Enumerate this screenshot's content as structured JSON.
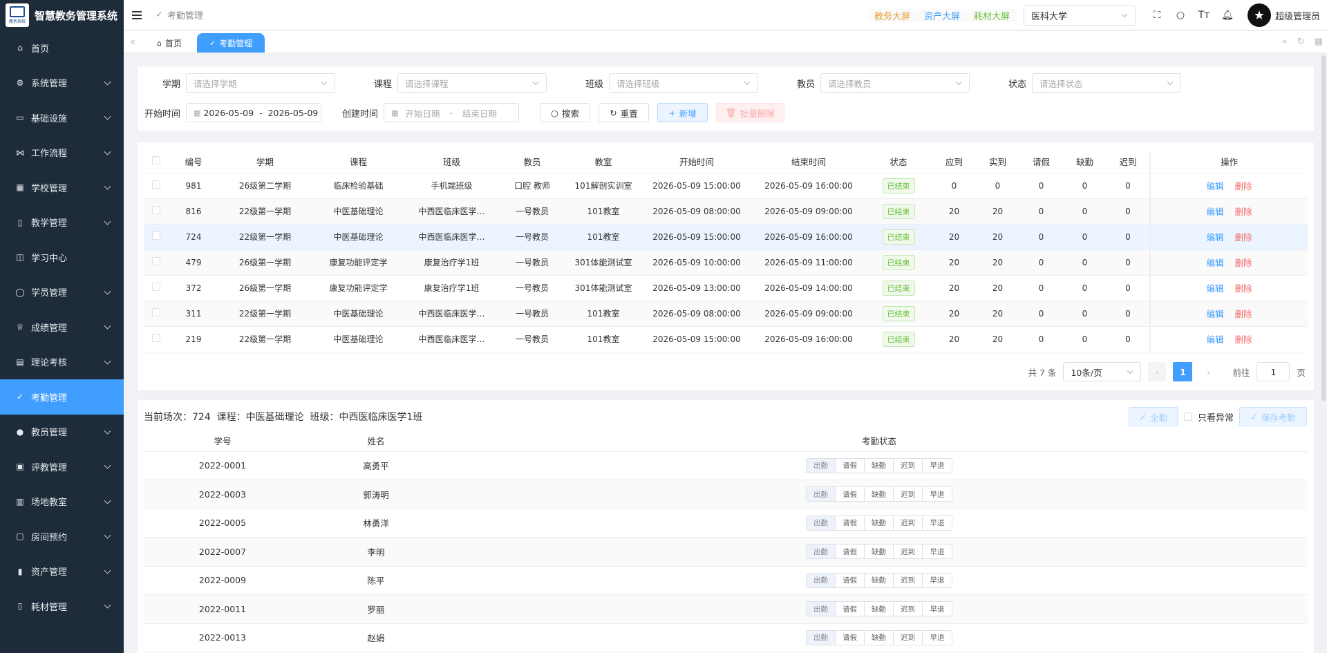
{
  "app": {
    "title": "智慧教务管理系统",
    "logo_caption": "教务系统"
  },
  "sidebar": {
    "items": [
      {
        "label": "首页",
        "icon": "home-icon",
        "glyph": "⌂",
        "has_children": false
      },
      {
        "label": "系统管理",
        "icon": "gear-icon",
        "glyph": "⚙",
        "has_children": true
      },
      {
        "label": "基础设施",
        "icon": "monitor-icon",
        "glyph": "▭",
        "has_children": true
      },
      {
        "label": "工作流程",
        "icon": "workflow-icon",
        "glyph": "⋈",
        "has_children": true
      },
      {
        "label": "学校管理",
        "icon": "school-icon",
        "glyph": "▦",
        "has_children": true
      },
      {
        "label": "教学管理",
        "icon": "book-icon",
        "glyph": "▯",
        "has_children": true
      },
      {
        "label": "学习中心",
        "icon": "open-book-icon",
        "glyph": "◫",
        "has_children": false
      },
      {
        "label": "学员管理",
        "icon": "user-icon",
        "glyph": "◯",
        "has_children": true
      },
      {
        "label": "成绩管理",
        "icon": "medal-icon",
        "glyph": "♕",
        "has_children": true
      },
      {
        "label": "理论考核",
        "icon": "exam-icon",
        "glyph": "▤",
        "has_children": true
      },
      {
        "label": "考勤管理",
        "icon": "check-icon",
        "glyph": "✓",
        "has_children": false,
        "active": true
      },
      {
        "label": "教员管理",
        "icon": "teacher-icon",
        "glyph": "●",
        "has_children": true
      },
      {
        "label": "评教管理",
        "icon": "evaluate-icon",
        "glyph": "▣",
        "has_children": true
      },
      {
        "label": "场地教室",
        "icon": "building-icon",
        "glyph": "▥",
        "has_children": true
      },
      {
        "label": "房间预约",
        "icon": "room-icon",
        "glyph": "▢",
        "has_children": true
      },
      {
        "label": "资产管理",
        "icon": "chart-icon",
        "glyph": "▮",
        "has_children": true
      },
      {
        "label": "耗材管理",
        "icon": "bookmark-icon",
        "glyph": "▯",
        "has_children": true
      }
    ]
  },
  "header": {
    "breadcrumb": "考勤管理",
    "screens": [
      "教务大屏",
      "资产大屏",
      "耗材大屏"
    ],
    "university": "医科大学",
    "username": "超级管理员"
  },
  "tabs": [
    {
      "label": "首页",
      "icon": "home-icon"
    },
    {
      "label": "考勤管理",
      "icon": "check-icon",
      "active": true
    }
  ],
  "filter": {
    "semester": {
      "label": "学期",
      "placeholder": "请选择学期"
    },
    "course": {
      "label": "课程",
      "placeholder": "请选择课程"
    },
    "class": {
      "label": "班级",
      "placeholder": "请选择班级"
    },
    "teacher": {
      "label": "教员",
      "placeholder": "请选择教员"
    },
    "status": {
      "label": "状态",
      "placeholder": "请选择状态"
    },
    "start_time": {
      "label": "开始时间",
      "from": "2026-05-09",
      "sep": "-",
      "to": "2026-05-09"
    },
    "create_time": {
      "label": "创建时间",
      "from_ph": "开始日期",
      "sep": "-",
      "to_ph": "结束日期"
    },
    "search": "搜索",
    "reset": "重置",
    "add": "新增",
    "batch_delete": "批量删除"
  },
  "table": {
    "columns": [
      "编号",
      "学期",
      "课程",
      "班级",
      "教员",
      "教室",
      "开始时间",
      "结束时间",
      "状态",
      "应到",
      "实到",
      "请假",
      "缺勤",
      "迟到",
      "操作"
    ],
    "edit": "编辑",
    "delete": "删除",
    "rows": [
      [
        "981",
        "26级第二学期",
        "临床检验基础",
        "手机端班级",
        "口腔 教师",
        "101解剖实训室",
        "2026-05-09 15:00:00",
        "2026-05-09 16:00:00",
        "已结束",
        "0",
        "0",
        "0",
        "0",
        "0"
      ],
      [
        "816",
        "22级第一学期",
        "中医基础理论",
        "中西医临床医学…",
        "一号教员",
        "101教室",
        "2026-05-09 08:00:00",
        "2026-05-09 09:00:00",
        "已结束",
        "20",
        "20",
        "0",
        "0",
        "0"
      ],
      [
        "724",
        "22级第一学期",
        "中医基础理论",
        "中西医临床医学…",
        "一号教员",
        "101教室",
        "2026-05-09 15:00:00",
        "2026-05-09 16:00:00",
        "已结束",
        "20",
        "20",
        "0",
        "0",
        "0"
      ],
      [
        "479",
        "26级第一学期",
        "康复功能评定学",
        "康复治疗学1班",
        "一号教员",
        "301体能测试室",
        "2026-05-09 10:00:00",
        "2026-05-09 11:00:00",
        "已结束",
        "20",
        "20",
        "0",
        "0",
        "0"
      ],
      [
        "372",
        "26级第一学期",
        "康复功能评定学",
        "康复治疗学1班",
        "一号教员",
        "301体能测试室",
        "2026-05-09 13:00:00",
        "2026-05-09 14:00:00",
        "已结束",
        "20",
        "20",
        "0",
        "0",
        "0"
      ],
      [
        "311",
        "22级第一学期",
        "中医基础理论",
        "中西医临床医学…",
        "一号教员",
        "101教室",
        "2026-05-09 08:00:00",
        "2026-05-09 09:00:00",
        "已结束",
        "20",
        "20",
        "0",
        "0",
        "0"
      ],
      [
        "219",
        "22级第一学期",
        "中医基础理论",
        "中西医临床医学…",
        "一号教员",
        "101教室",
        "2026-05-09 15:00:00",
        "2026-05-09 16:00:00",
        "已结束",
        "20",
        "20",
        "0",
        "0",
        "0"
      ]
    ],
    "highlight_row": 2
  },
  "pagination": {
    "total": "共 7 条",
    "page_size": "10条/页",
    "current": "1",
    "goto_label": "前往",
    "goto_value": "1",
    "page_unit": "页"
  },
  "attendance": {
    "session_text": "当前场次：724  课程：中医基础理论  班级：中西医临床医学1班",
    "select_all": "全勤",
    "only_abnormal": "只看异常",
    "save": "保存考勤",
    "columns": [
      "学号",
      "姓名",
      "考勤状态"
    ],
    "options": [
      "出勤",
      "请假",
      "缺勤",
      "迟到",
      "早退"
    ],
    "rows": [
      [
        "2022-0001",
        "高勇平"
      ],
      [
        "2022-0003",
        "郭涛明"
      ],
      [
        "2022-0005",
        "林勇洋"
      ],
      [
        "2022-0007",
        "李明"
      ],
      [
        "2022-0009",
        "陈平"
      ],
      [
        "2022-0011",
        "罗丽"
      ],
      [
        "2022-0013",
        "赵娟"
      ]
    ]
  },
  "colors": {
    "primary": "#409eff",
    "sidebar_bg": "#1d2b3a",
    "danger": "#f56c6c",
    "success": "#67c23a",
    "warning": "#e6a23c"
  }
}
